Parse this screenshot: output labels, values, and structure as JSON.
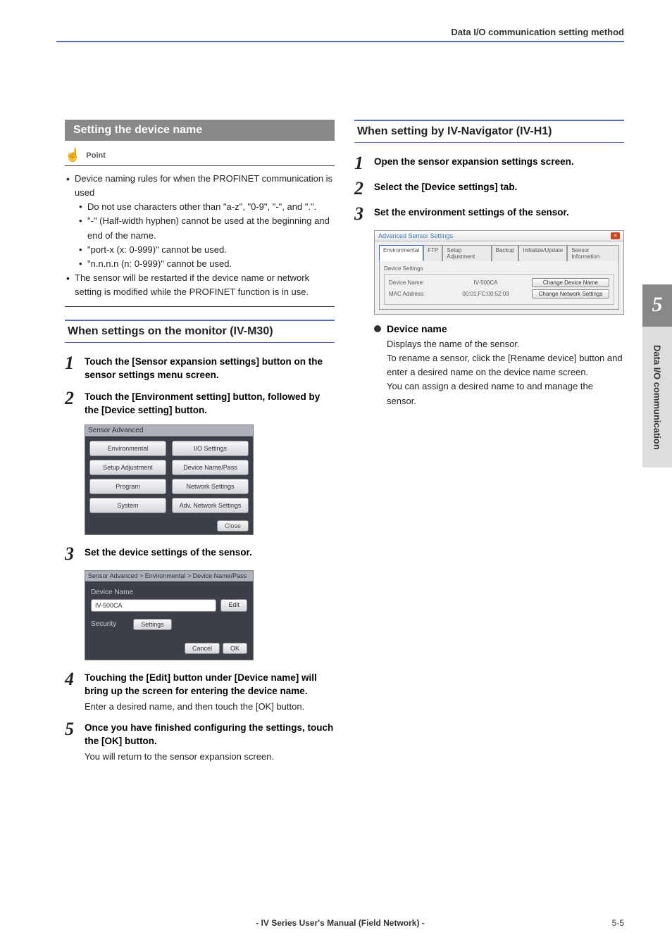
{
  "header": {
    "title": "Data I/O communication setting method"
  },
  "left": {
    "section_title": "Setting the device name",
    "point_label": "Point",
    "points": [
      {
        "text": "Device naming rules for when the PROFINET communication is used",
        "sub": [
          "Do not use characters other than \"a-z\", \"0-9\", \"-\", and \".\".",
          "\"-\" (Half-width hyphen) cannot be used at the beginning and end of the name.",
          "\"port-x (x: 0-999)\" cannot be used.",
          "\"n.n.n.n (n: 0-999)\" cannot be used."
        ]
      },
      {
        "text": "The sensor will be restarted if the device name or network setting is modified while the PROFINET function is in use."
      }
    ],
    "subsection_title": "When settings on the monitor (IV-M30)",
    "steps": [
      {
        "num": "1",
        "title": "Touch the [Sensor expansion settings] button on the sensor settings menu screen."
      },
      {
        "num": "2",
        "title": "Touch the [Environment setting] button, followed by the [Device setting] button."
      },
      {
        "num": "3",
        "title": "Set the device settings of the sensor."
      },
      {
        "num": "4",
        "title": "Touching the [Edit] button under [Device name] will bring up the screen for entering the device name.",
        "desc": "Enter a desired name, and then touch the [OK] button."
      },
      {
        "num": "5",
        "title": "Once you have finished configuring the settings, touch the [OK] button.",
        "desc": "You will return to the sensor expansion screen."
      }
    ],
    "ss1": {
      "header": "Sensor Advanced",
      "left_buttons": [
        "Environmental",
        "Setup Adjustment",
        "Program",
        "System"
      ],
      "right_buttons": [
        "I/O Settings",
        "Device Name/Pass",
        "Network Settings",
        "Adv. Network Settings"
      ],
      "close": "Close"
    },
    "ss2": {
      "header": "Sensor Advanced > Environmental > Device Name/Pass",
      "label_devname": "Device Name",
      "devname_value": "IV-500CA",
      "edit": "Edit",
      "security": "Security",
      "settings": "Settings",
      "cancel": "Cancel",
      "ok": "OK"
    }
  },
  "right": {
    "subsection_title": "When setting by IV-Navigator (IV-H1)",
    "steps": [
      {
        "num": "1",
        "title": "Open the sensor expansion settings screen."
      },
      {
        "num": "2",
        "title": "Select the [Device settings] tab."
      },
      {
        "num": "3",
        "title": "Set the environment settings of the sensor."
      }
    ],
    "ss3": {
      "title": "Advanced Sensor Settings",
      "tabs": [
        "Environmental",
        "FTP",
        "Setup Adjustment",
        "Backup",
        "Initialize/Update",
        "Sensor Information"
      ],
      "fieldset": "Device Settings",
      "row1_label": "Device Name:",
      "row1_value": "IV-500CA",
      "row1_btn": "Change Device Name",
      "row2_label": "MAC Address:",
      "row2_value": "00:01:FC:00:52:03",
      "row2_btn": "Change Network Settings"
    },
    "bullet_title": "Device name",
    "bullet_desc": "Displays the name of the sensor.\nTo rename a sensor, click the [Rename device] button and enter a desired name on the device name screen.\nYou can assign a desired name to and manage the sensor."
  },
  "side": {
    "num": "5",
    "label": "Data I/O communication"
  },
  "footer": {
    "center": "- IV Series User's Manual (Field Network) -",
    "right": "5-5"
  }
}
